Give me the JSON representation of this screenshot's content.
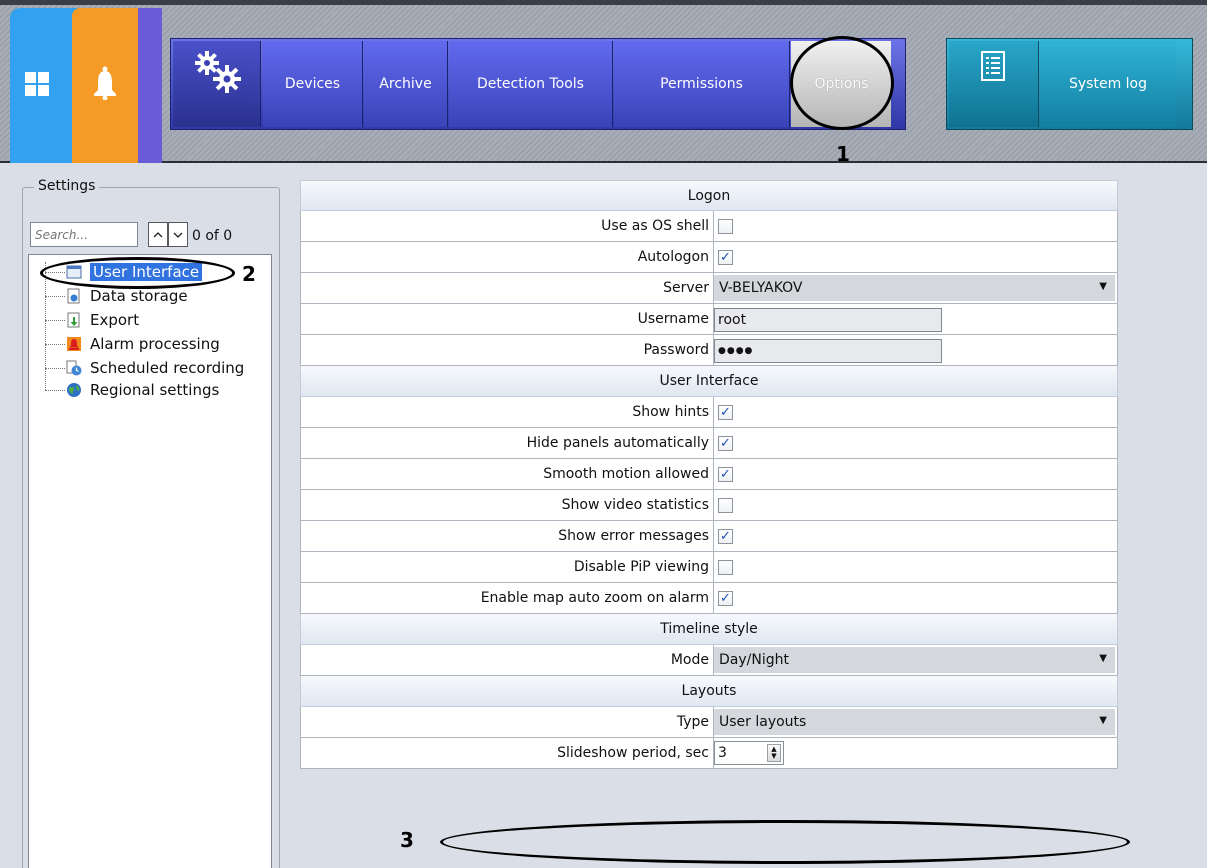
{
  "toolbar": {
    "nav_items": [
      {
        "label": "Devices"
      },
      {
        "label": "Archive"
      },
      {
        "label": "Detection Tools"
      },
      {
        "label": "Permissions"
      },
      {
        "label": "Options"
      }
    ],
    "system_log_label": "System log",
    "icons": [
      "windows-icon",
      "bell-icon",
      "gears-icon",
      "checklist-icon"
    ]
  },
  "annotations": {
    "n1": "1",
    "n2": "2",
    "n3": "3"
  },
  "settings": {
    "title": "Settings",
    "search_placeholder": "Search...",
    "counter": "0 of 0",
    "tree": [
      {
        "label": "User Interface",
        "selected": true
      },
      {
        "label": "Data storage"
      },
      {
        "label": "Export"
      },
      {
        "label": "Alarm processing"
      },
      {
        "label": "Scheduled recording"
      },
      {
        "label": "Regional settings"
      }
    ]
  },
  "grid": {
    "logon": {
      "title": "Logon",
      "use_os_shell": {
        "label": "Use as OS shell",
        "checked": false
      },
      "autologon": {
        "label": "Autologon",
        "checked": true
      },
      "server": {
        "label": "Server",
        "value": "V-BELYAKOV"
      },
      "username": {
        "label": "Username",
        "value": "root"
      },
      "password": {
        "label": "Password",
        "value": "●●●●"
      }
    },
    "ui": {
      "title": "User Interface",
      "rows": [
        {
          "label": "Show hints",
          "checked": true
        },
        {
          "label": "Hide panels automatically",
          "checked": true
        },
        {
          "label": "Smooth motion allowed",
          "checked": true
        },
        {
          "label": "Show video statistics",
          "checked": false
        },
        {
          "label": "Show error messages",
          "checked": true
        },
        {
          "label": "Disable PiP viewing",
          "checked": false
        },
        {
          "label": "Enable map auto zoom on alarm",
          "checked": true
        }
      ]
    },
    "timeline": {
      "title": "Timeline style",
      "mode": {
        "label": "Mode",
        "value": "Day/Night"
      }
    },
    "layouts": {
      "title": "Layouts",
      "type": {
        "label": "Type",
        "value": "User layouts"
      },
      "slideshow": {
        "label": "Slideshow period, sec",
        "value": "3"
      }
    }
  },
  "colors": {
    "nav_blue": "#4a51c9",
    "log_teal": "#1d97bb",
    "selection": "#2f72e0",
    "tile_blue": "#32a2f0",
    "tile_orange": "#f59a24"
  }
}
